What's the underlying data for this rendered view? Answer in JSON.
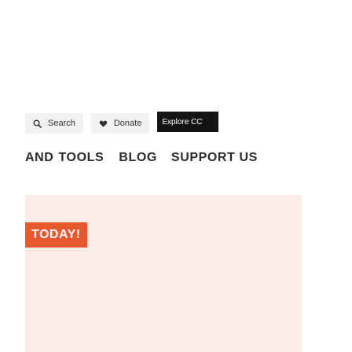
{
  "utility_bar": {
    "search_label": "Search",
    "search_icon": "search-icon",
    "donate_label": "Donate",
    "donate_icon": "heart-icon",
    "explore_label": "Explore CC"
  },
  "nav": {
    "items": [
      "AND",
      "TOOLS",
      "BLOG",
      "SUPPORT US"
    ]
  },
  "hero": {
    "badge_text": "TODAY!"
  },
  "colors": {
    "explore_bg": "#141414",
    "util_bg": "#f2f2f2",
    "hero_bg": "#fdebe5",
    "badge_bg": "#e9572f",
    "nav_text": "#2b2b2b"
  }
}
